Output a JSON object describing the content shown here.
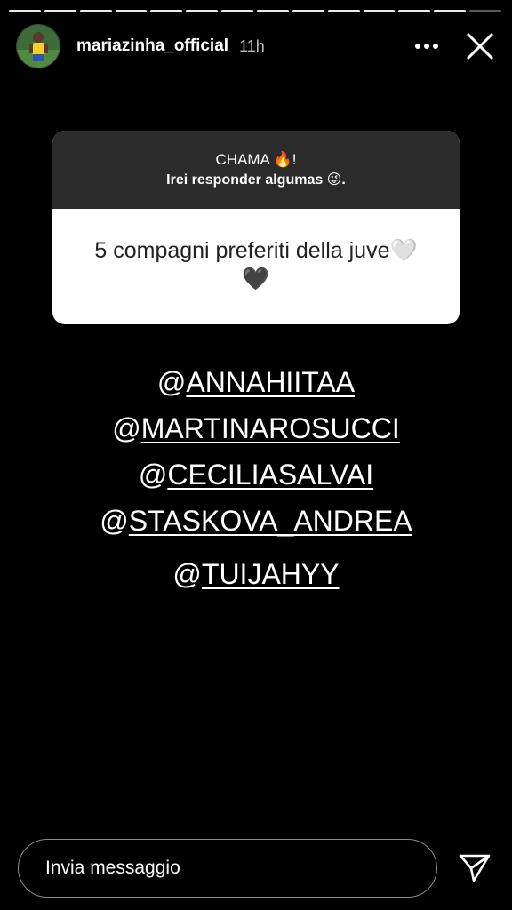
{
  "story": {
    "progress_segments": 14,
    "active_segment_index": 13,
    "username": "mariazinha_official",
    "time": "11h"
  },
  "question": {
    "prompt_line1": "CHAMA 🔥!",
    "prompt_line2": "Irei responder algumas 😜.",
    "answer_line1": "5 compagni preferiti della juve🤍",
    "answer_line2": "🖤"
  },
  "mentions": [
    {
      "at": "@",
      "handle": "ANNAHIITAA"
    },
    {
      "at": "@",
      "handle": "MARTINAROSUCCI"
    },
    {
      "at": "@",
      "handle": "CECILIASALVAI"
    },
    {
      "at": "@",
      "handle": "STASKOVA_ANDREA"
    },
    {
      "at": "@",
      "handle": "TUIJAHYY"
    }
  ],
  "footer": {
    "message_placeholder": "Invia messaggio"
  },
  "icons": {
    "more": "more-icon",
    "close": "close-icon",
    "send": "send-icon"
  },
  "colors": {
    "background": "#000000",
    "question_header": "#2b2b2b",
    "question_body": "#ffffff"
  }
}
